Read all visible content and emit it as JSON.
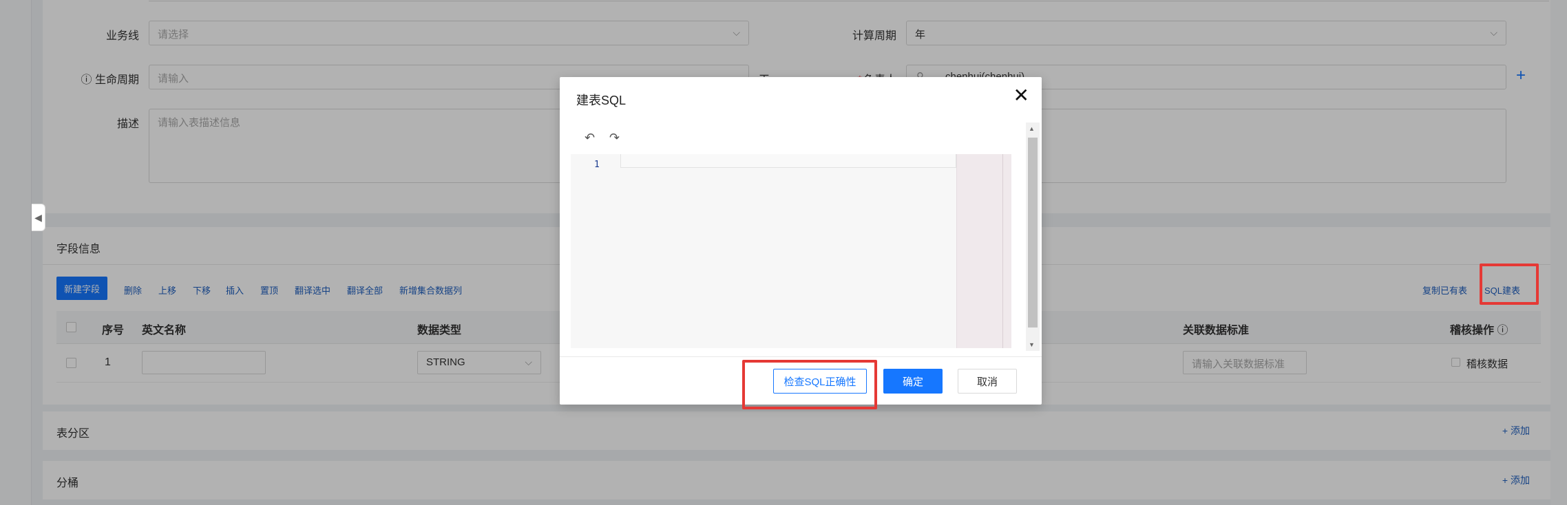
{
  "form": {
    "business_line_label": "业务线",
    "business_line_placeholder": "请选择",
    "calc_period_label": "计算周期",
    "calc_period_value": "年",
    "lifecycle_label": "生命周期",
    "lifecycle_placeholder": "请输入",
    "lifecycle_unit": "天",
    "owner_label": "负责人",
    "owner_value": "chenhui(chenhui)",
    "owner_add_icon": "+",
    "desc_label": "描述",
    "desc_placeholder": "请输入表描述信息"
  },
  "fields": {
    "section_title": "字段信息",
    "new_field_button": "新建字段",
    "toolbar": [
      "删除",
      "上移",
      "下移",
      "插入",
      "置顶",
      "翻译选中",
      "翻译全部",
      "新增集合数据列"
    ],
    "copy_table_link": "复制已有表",
    "sql_create_link": "SQL建表",
    "columns": {
      "index": "序号",
      "en_name": "英文名称",
      "data_type": "数据类型",
      "standard": "关联数据标准",
      "audit": "稽核操作"
    },
    "rows": [
      {
        "index": "1",
        "en_name": "",
        "data_type": "STRING",
        "standard_placeholder": "请输入关联数据标准",
        "audit_label": "稽核数据"
      }
    ]
  },
  "partition": {
    "title": "表分区",
    "add": "+ 添加"
  },
  "bucket": {
    "title": "分桶",
    "add": "+ 添加"
  },
  "modal": {
    "title": "建表SQL",
    "close": "✕",
    "undo": "↶",
    "redo": "↷",
    "line_number": "1",
    "scroll_up": "▲",
    "scroll_down": "▼",
    "check_button": "检查SQL正确性",
    "ok_button": "确定",
    "cancel_button": "取消"
  },
  "icons": {
    "collapse": "◀",
    "info": "ⓘ",
    "chevron": "⌵",
    "search": "⚲"
  },
  "colors": {
    "primary": "#1677ff",
    "highlight": "#e53935",
    "required": "#f5222d"
  }
}
